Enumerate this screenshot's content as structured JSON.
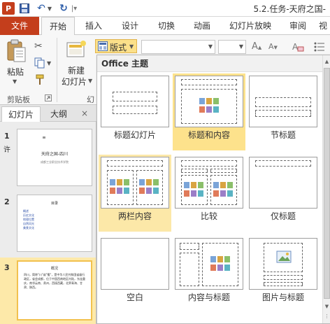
{
  "titlebar": {
    "app_icon_label": "P",
    "window_title": "5.2.任务-天府之国-"
  },
  "tabs": [
    {
      "label": "文件"
    },
    {
      "label": "开始"
    },
    {
      "label": "插入"
    },
    {
      "label": "设计"
    },
    {
      "label": "切换"
    },
    {
      "label": "动画"
    },
    {
      "label": "幻灯片放映"
    },
    {
      "label": "审阅"
    },
    {
      "label": "视"
    }
  ],
  "ribbon": {
    "paste_label": "粘贴",
    "new_slide_label": "新建",
    "new_slide_label2": "幻灯片",
    "layout_button_label": "版式",
    "clipboard_group": "剪贴板",
    "slides_group_partial": "幻"
  },
  "leftpane": {
    "tab_slides": "幻灯片",
    "tab_outline": "大纲",
    "slides": [
      {
        "number": "1",
        "title": "天府之国-四川",
        "subtitle": "成都工业职业技术学院",
        "note": "许"
      },
      {
        "number": "2",
        "title": "目录",
        "items": [
          "概述",
          "历史文化",
          "地理位置",
          "自然风光",
          "美食文化"
        ]
      },
      {
        "number": "3",
        "title": "概况",
        "body": "四川，简称\"川\"或\"蜀\"，是中华人民共和国省级行政区，省会成都，位于中国西南地区内陆，东连重庆，南邻云南、贵州，西接西藏，北界青海、甘肃、陕西。"
      }
    ]
  },
  "gallery": {
    "header": "Office 主题",
    "layouts": [
      {
        "name": "标题幻灯片"
      },
      {
        "name": "标题和内容"
      },
      {
        "name": "节标题"
      },
      {
        "name": "两栏内容"
      },
      {
        "name": "比较"
      },
      {
        "name": "仅标题"
      },
      {
        "name": "空白"
      },
      {
        "name": "内容与标题"
      },
      {
        "name": "图片与标题"
      }
    ]
  },
  "colors": {
    "accent": "#c43e1c",
    "selection": "#fde28c",
    "hover": "#fce8a8"
  }
}
